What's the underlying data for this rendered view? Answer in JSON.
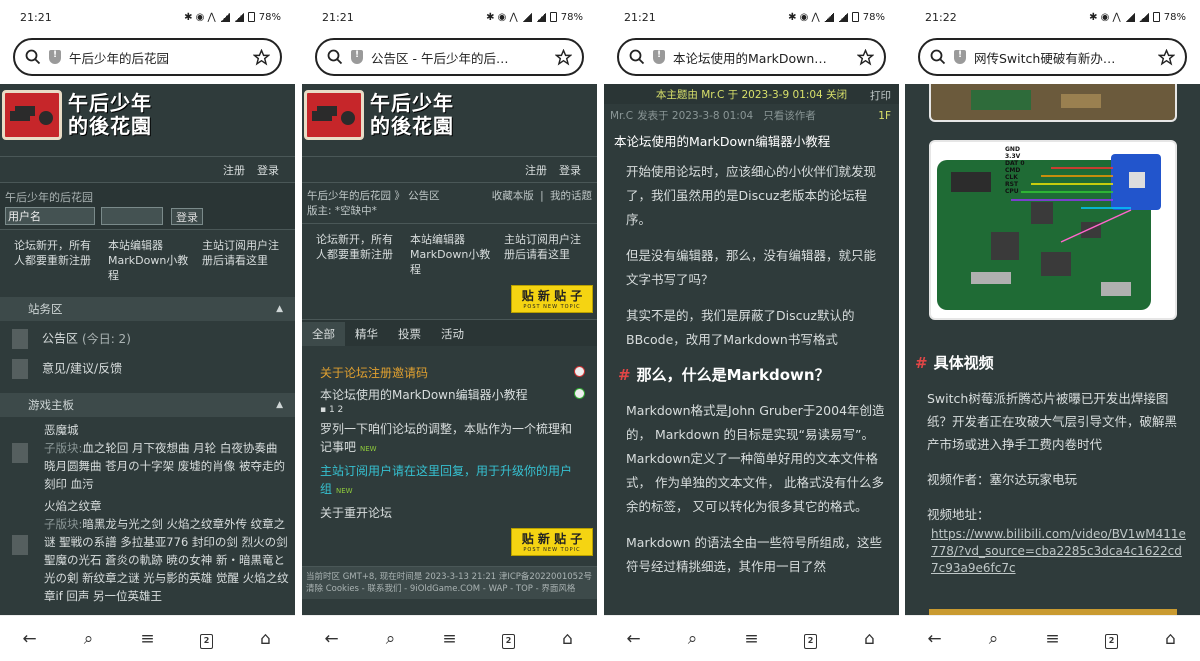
{
  "phones": [
    {
      "time": "21:21",
      "battery": "78%",
      "url": "午后少年的后花园"
    },
    {
      "time": "21:21",
      "battery": "78%",
      "url": "公告区 - 午后少年的后…"
    },
    {
      "time": "21:21",
      "battery": "78%",
      "url": "本论坛使用的MarkDown…"
    },
    {
      "time": "21:22",
      "battery": "78%",
      "url": "网传Switch硬破有新办…"
    }
  ],
  "status_icons": "✱ ◉ ⋀",
  "logo": {
    "line1": "午后少年",
    "line2": "的後花園",
    "line2_alt": "的後花園"
  },
  "p1": {
    "register": "注册",
    "login": "登录",
    "site_name": "午后少年的后花园",
    "username_label": "用户名",
    "login_button": "登录",
    "notices": [
      "论坛新开，所有人都要重新注册",
      "本站编辑器MarkDown小教程",
      "主站订阅用户注册后请看这里"
    ],
    "station_section": "站务区",
    "board1": "公告区",
    "board1_today": "(今日: 2)",
    "board2": "意见/建议/反馈",
    "game_section": "游戏主板",
    "forum1_title": "恶魔城",
    "forum1_sub_label": "子版块:",
    "forum1_subs": "血之轮回  月下夜想曲  月轮  白夜协奏曲  晓月圆舞曲  苍月の十字架  废墟的肖像  被夺走的刻印  血污",
    "forum2_title": "火焰之纹章",
    "forum2_sub_label": "子版块:",
    "forum2_subs": "暗黑龙与光之剑  火焰之纹章外传  纹章之谜  聖戦の系譜  多拉基亚776  封印の剑  烈火の剑  聖魔の光石  蒼炎の軌跡  暁の女神  新・暗黒竜と光の剣  新纹章之谜 光与影的英雄  觉醒  火焰之纹章if  回声 另一位英雄王"
  },
  "p2": {
    "register": "注册",
    "login": "登录",
    "breadcrumb": "午后少年的后花园 》 公告区",
    "mod_label": "版主: *空缺中*",
    "fav": "收藏本版",
    "my_topics": "我的话题",
    "sep": "|",
    "notices": [
      "论坛新开，所有人都要重新注册",
      "本站编辑器MarkDown小教程",
      "主站订阅用户注册后请看这里"
    ],
    "post_button": "贴 新 贴 子",
    "post_button_sub": "POST NEW TOPIC",
    "tabs": [
      "全部",
      "精华",
      "投票",
      "活动"
    ],
    "threads": [
      {
        "title": "关于论坛注册邀请码",
        "color": "#e0a030"
      },
      {
        "title": "本论坛使用的MarkDown编辑器小教程",
        "color": "#d8dddd",
        "pages": "1  2"
      },
      {
        "title": "罗列一下咱们论坛的调整，本贴作为一个梳理和记事吧",
        "color": "#d8dddd",
        "new": "NEW"
      },
      {
        "title": "主站订阅用户请在这里回复，用于升级你的用户组",
        "color": "#36c0d0",
        "new": "NEW"
      },
      {
        "title": "关于重开论坛",
        "color": "#d8dddd"
      }
    ],
    "footer1": "当前时区 GMT+8, 现在时间是 2023-3-13 21:21 津ICP备2022001052号",
    "footer2": "清除 Cookies - 联系我们 - 9iOldGame.COM - WAP - TOP - 界面风格"
  },
  "p3": {
    "closed_notice": "本主题由 Mr.C 于 2023-3-9 01:04 关闭",
    "print": "打印",
    "author": "Mr.C",
    "posted": "发表于 2023-3-8 01:04",
    "only_author": "只看该作者",
    "floor": "1F",
    "post_title": "本论坛使用的MarkDown编辑器小教程",
    "para1": "开始使用论坛时，应该细心的小伙伴们就发现了，我们虽然用的是Discuz老版本的论坛程序。",
    "para2": "但是没有编辑器，那么，没有编辑器，就只能文字书写了吗？",
    "para3": "其实不是的，我们是屏蔽了Discuz默认的BBcode，改用了Markdown书写格式",
    "heading": "那么，什么是Markdown？",
    "para4": "Markdown格式是John Gruber于2004年创造的， Markdown 的目标是实现“易读易写”。 Markdown定义了一种简单好用的文本文件格式， 作为单独的文本文件， 此格式没有什么多余的标签， 又可以转化为很多其它的格式。",
    "para5": "Markdown 的语法全由一些符号所组成，这些符号经过精挑细选，其作用一目了然"
  },
  "p4": {
    "diagram_labels": [
      "GND",
      "3.3V",
      "DAT 0",
      "CMD",
      "CLK",
      "RST",
      "CPU"
    ],
    "heading": "具体视频",
    "para1": "Switch树莓派折腾芯片被曝已开发出焊接图纸？开发者正在攻破大气层引导文件，破解黑产市场或进入挣手工费内卷时代",
    "author": "视频作者：塞尔达玩家电玩",
    "url_label": "视频地址：",
    "url": "https://www.bilibili.com/video/BV1wM411e778/?vd_source=cba2285c3dca4c1622cd7c93a9e6fc7c"
  },
  "colors": {
    "content_bg": "#2f3b3b",
    "accent_red": "#e04646",
    "button_yellow": "#f5d412",
    "link_cyan": "#36c0d0",
    "closed_green": "#d8e06a"
  }
}
